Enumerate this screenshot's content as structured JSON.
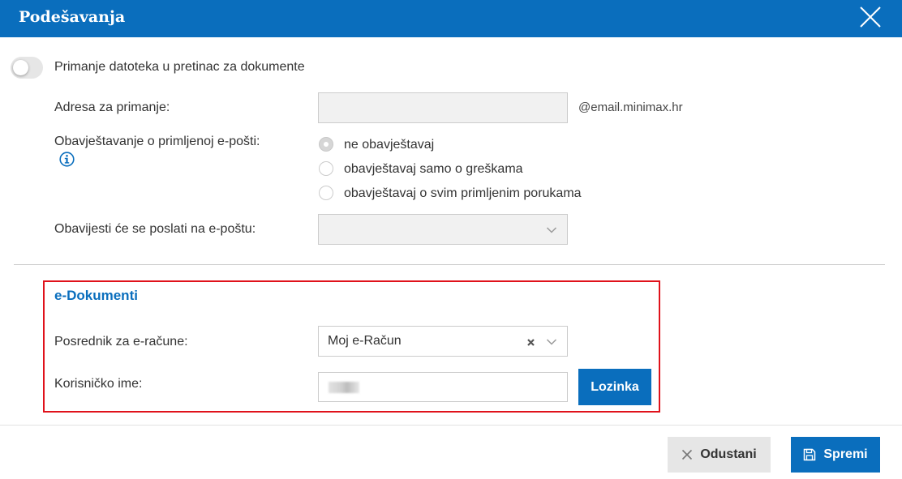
{
  "dialog": {
    "title": "Podešavanja"
  },
  "inbox": {
    "toggle_label": "Primanje datoteka u pretinac za dokumente",
    "toggle_on": false,
    "address_label": "Adresa za primanje:",
    "address_value": "",
    "address_suffix": "@email.minimax.hr",
    "notify_label": "Obavještavanje o primljenoj e-pošti:",
    "notify_options": [
      {
        "label": "ne obavještavaj",
        "checked": true
      },
      {
        "label": "obavještavaj samo o greškama",
        "checked": false
      },
      {
        "label": "obavještavaj o svim primljenim porukama",
        "checked": false
      }
    ],
    "send_to_label": "Obavijesti će se poslati na e-poštu:",
    "send_to_value": ""
  },
  "edocuments": {
    "title": "e-Dokumenti",
    "broker_label": "Posrednik za e-račune:",
    "broker_value": "Moj e-Račun",
    "username_label": "Korisničko ime:",
    "password_button": "Lozinka"
  },
  "footer": {
    "cancel_label": "Odustani",
    "save_label": "Spremi"
  },
  "colors": {
    "accent": "#0a6ebd",
    "highlight_border": "#e0121b"
  },
  "icons": {
    "close": "close-icon",
    "info": "info-icon",
    "chevron": "chevron-down-icon",
    "clear": "clear-icon",
    "cancel": "x-icon",
    "save": "save-icon"
  }
}
